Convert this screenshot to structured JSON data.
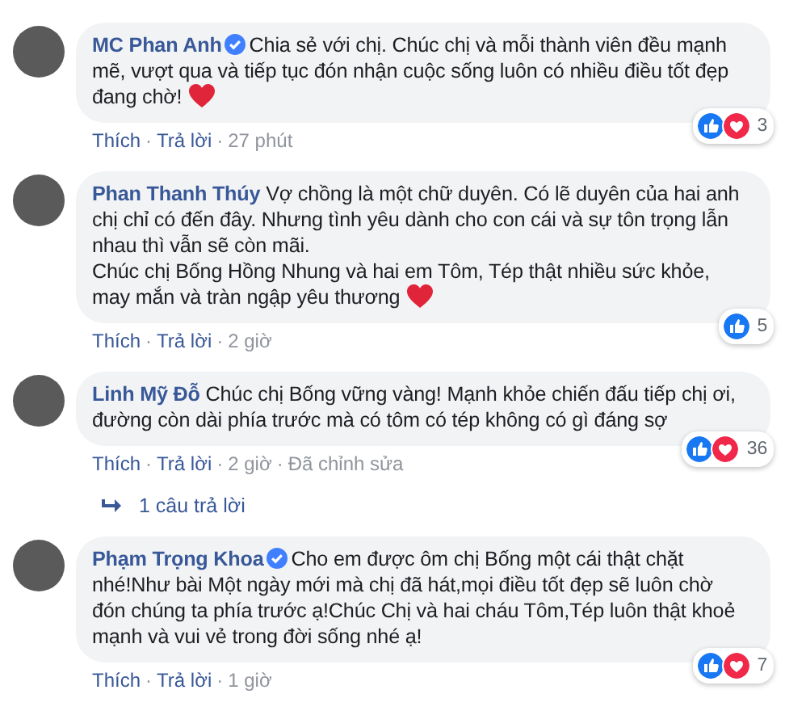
{
  "meta_separator": "·",
  "comments": [
    {
      "author": "MC Phan Anh",
      "verified": true,
      "paragraphs": [
        "Chia sẻ với chị. Chúc chị và mỗi thành viên đều mạnh mẽ, vượt qua và tiếp tục đón nhận cuộc sống luôn có nhiều điều tốt đẹp đang chờ!"
      ],
      "heart": true,
      "like_reaction": true,
      "love_reaction": true,
      "reaction_count": "3",
      "meta": [
        "Thích",
        "Trả lời",
        "27 phút"
      ]
    },
    {
      "author": "Phan Thanh Thúy",
      "verified": false,
      "paragraphs": [
        "Vợ chồng là một chữ duyên. Có lẽ duyên của hai anh chị chỉ có đến đây. Nhưng tình yêu dành cho con cái và sự tôn trọng lẫn nhau thì vẫn sẽ còn mãi.",
        "Chúc chị Bống Hồng Nhung và hai em Tôm, Tép thật nhiều sức khỏe, may mắn và tràn ngập yêu thương"
      ],
      "heart": true,
      "like_reaction": true,
      "love_reaction": false,
      "reaction_count": "5",
      "meta": [
        "Thích",
        "Trả lời",
        "2 giờ"
      ]
    },
    {
      "author": "Linh Mỹ Đỗ",
      "verified": false,
      "paragraphs": [
        "Chúc chị Bống vững vàng! Mạnh khỏe chiến đấu tiếp chị ơi, đường còn dài phía trước mà có tôm có tép không có gì đáng sợ"
      ],
      "heart": false,
      "like_reaction": true,
      "love_reaction": true,
      "reaction_count": "36",
      "meta": [
        "Thích",
        "Trả lời",
        "2 giờ",
        "Đã chỉnh sửa"
      ],
      "replies": "1 câu trả lời"
    },
    {
      "author": "Phạm Trọng Khoa",
      "verified": true,
      "paragraphs": [
        "Cho em được ôm chị Bống một cái thật chặt nhé!Như bài Một ngày mới mà chị đã hát,mọi điều tốt đẹp sẽ luôn chờ đón chúng ta phía trước ạ!Chúc Chị và hai cháu Tôm,Tép luôn thật khoẻ mạnh và vui vẻ trong đời sống nhé ạ!"
      ],
      "heart": false,
      "like_reaction": true,
      "love_reaction": true,
      "reaction_count": "7",
      "meta": [
        "Thích",
        "Trả lời",
        "1 giờ"
      ]
    }
  ]
}
